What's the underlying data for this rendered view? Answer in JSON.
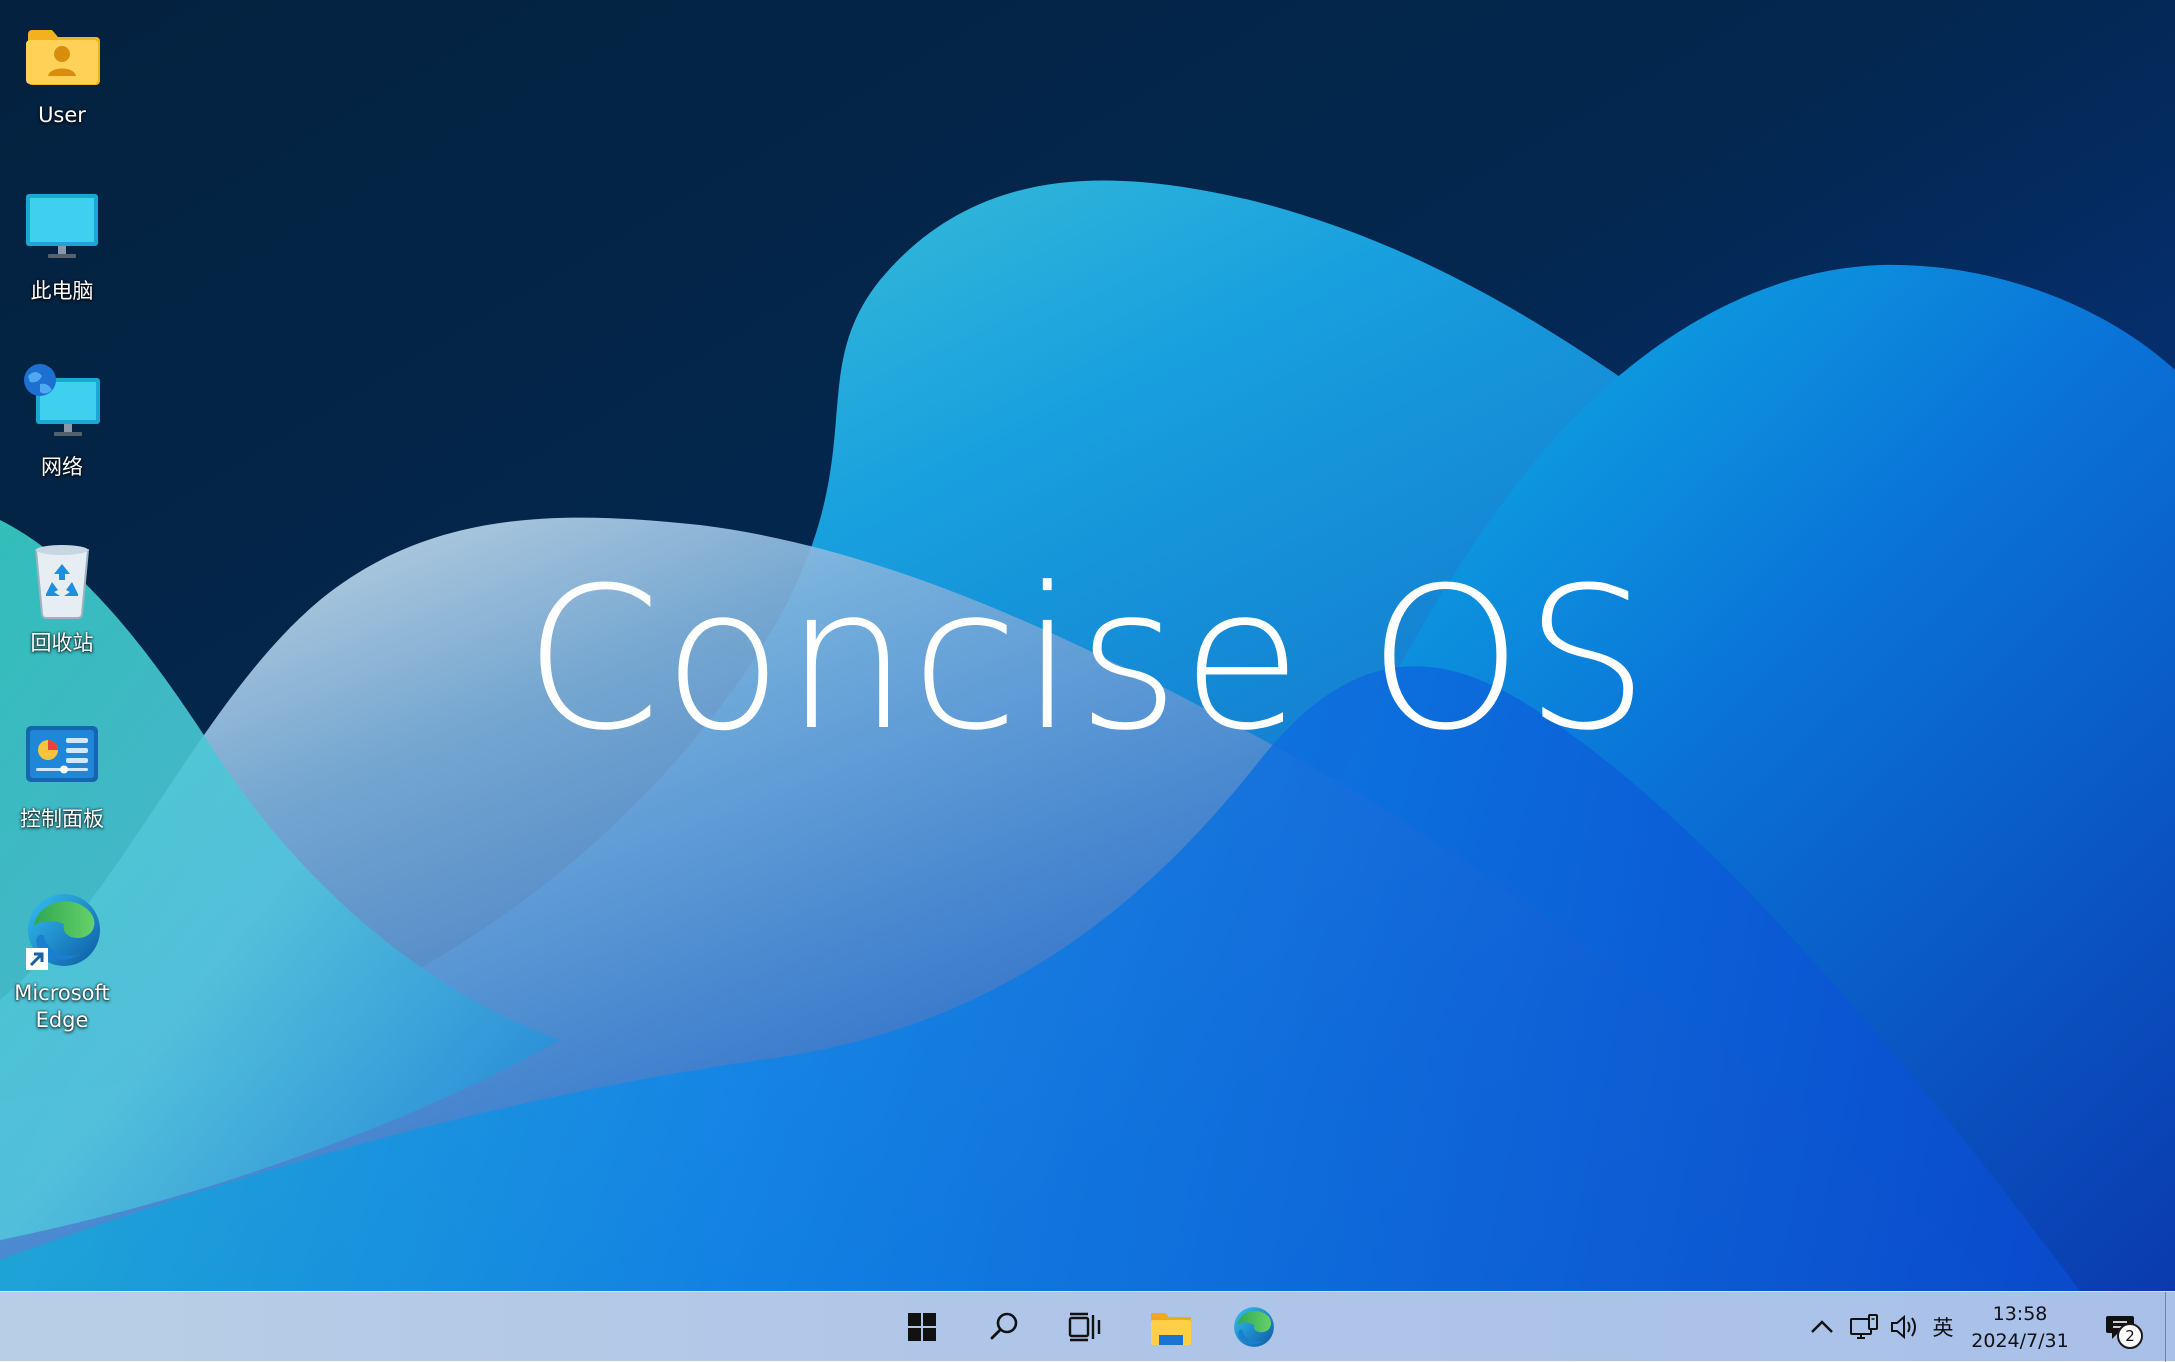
{
  "wallpaper": {
    "title": "Concise OS"
  },
  "desktop_icons": [
    {
      "label": "User",
      "icon": "user-folder-icon"
    },
    {
      "label": "此电脑",
      "icon": "this-pc-icon"
    },
    {
      "label": "网络",
      "icon": "network-icon"
    },
    {
      "label": "回收站",
      "icon": "recycle-bin-icon"
    },
    {
      "label": "控制面板",
      "icon": "control-panel-icon"
    },
    {
      "label": "Microsoft Edge",
      "icon": "edge-icon"
    }
  ],
  "taskbar": {
    "pinned": [
      {
        "name": "start-button",
        "icon": "windows-logo-icon"
      },
      {
        "name": "search-button",
        "icon": "search-icon"
      },
      {
        "name": "task-view-button",
        "icon": "task-view-icon"
      },
      {
        "name": "file-explorer-button",
        "icon": "folder-icon"
      },
      {
        "name": "edge-button",
        "icon": "edge-icon"
      }
    ],
    "tray": {
      "input_method": "英",
      "icons": [
        "chevron-up-icon",
        "network-status-icon",
        "volume-icon"
      ]
    },
    "clock": {
      "time": "13:58",
      "date": "2024/7/31"
    },
    "notifications": {
      "count": "2"
    }
  },
  "colors": {
    "taskbar": "#b0c6e8",
    "wallpaper_dark": "#04244a",
    "wallpaper_accent": "#1f8fe6"
  }
}
